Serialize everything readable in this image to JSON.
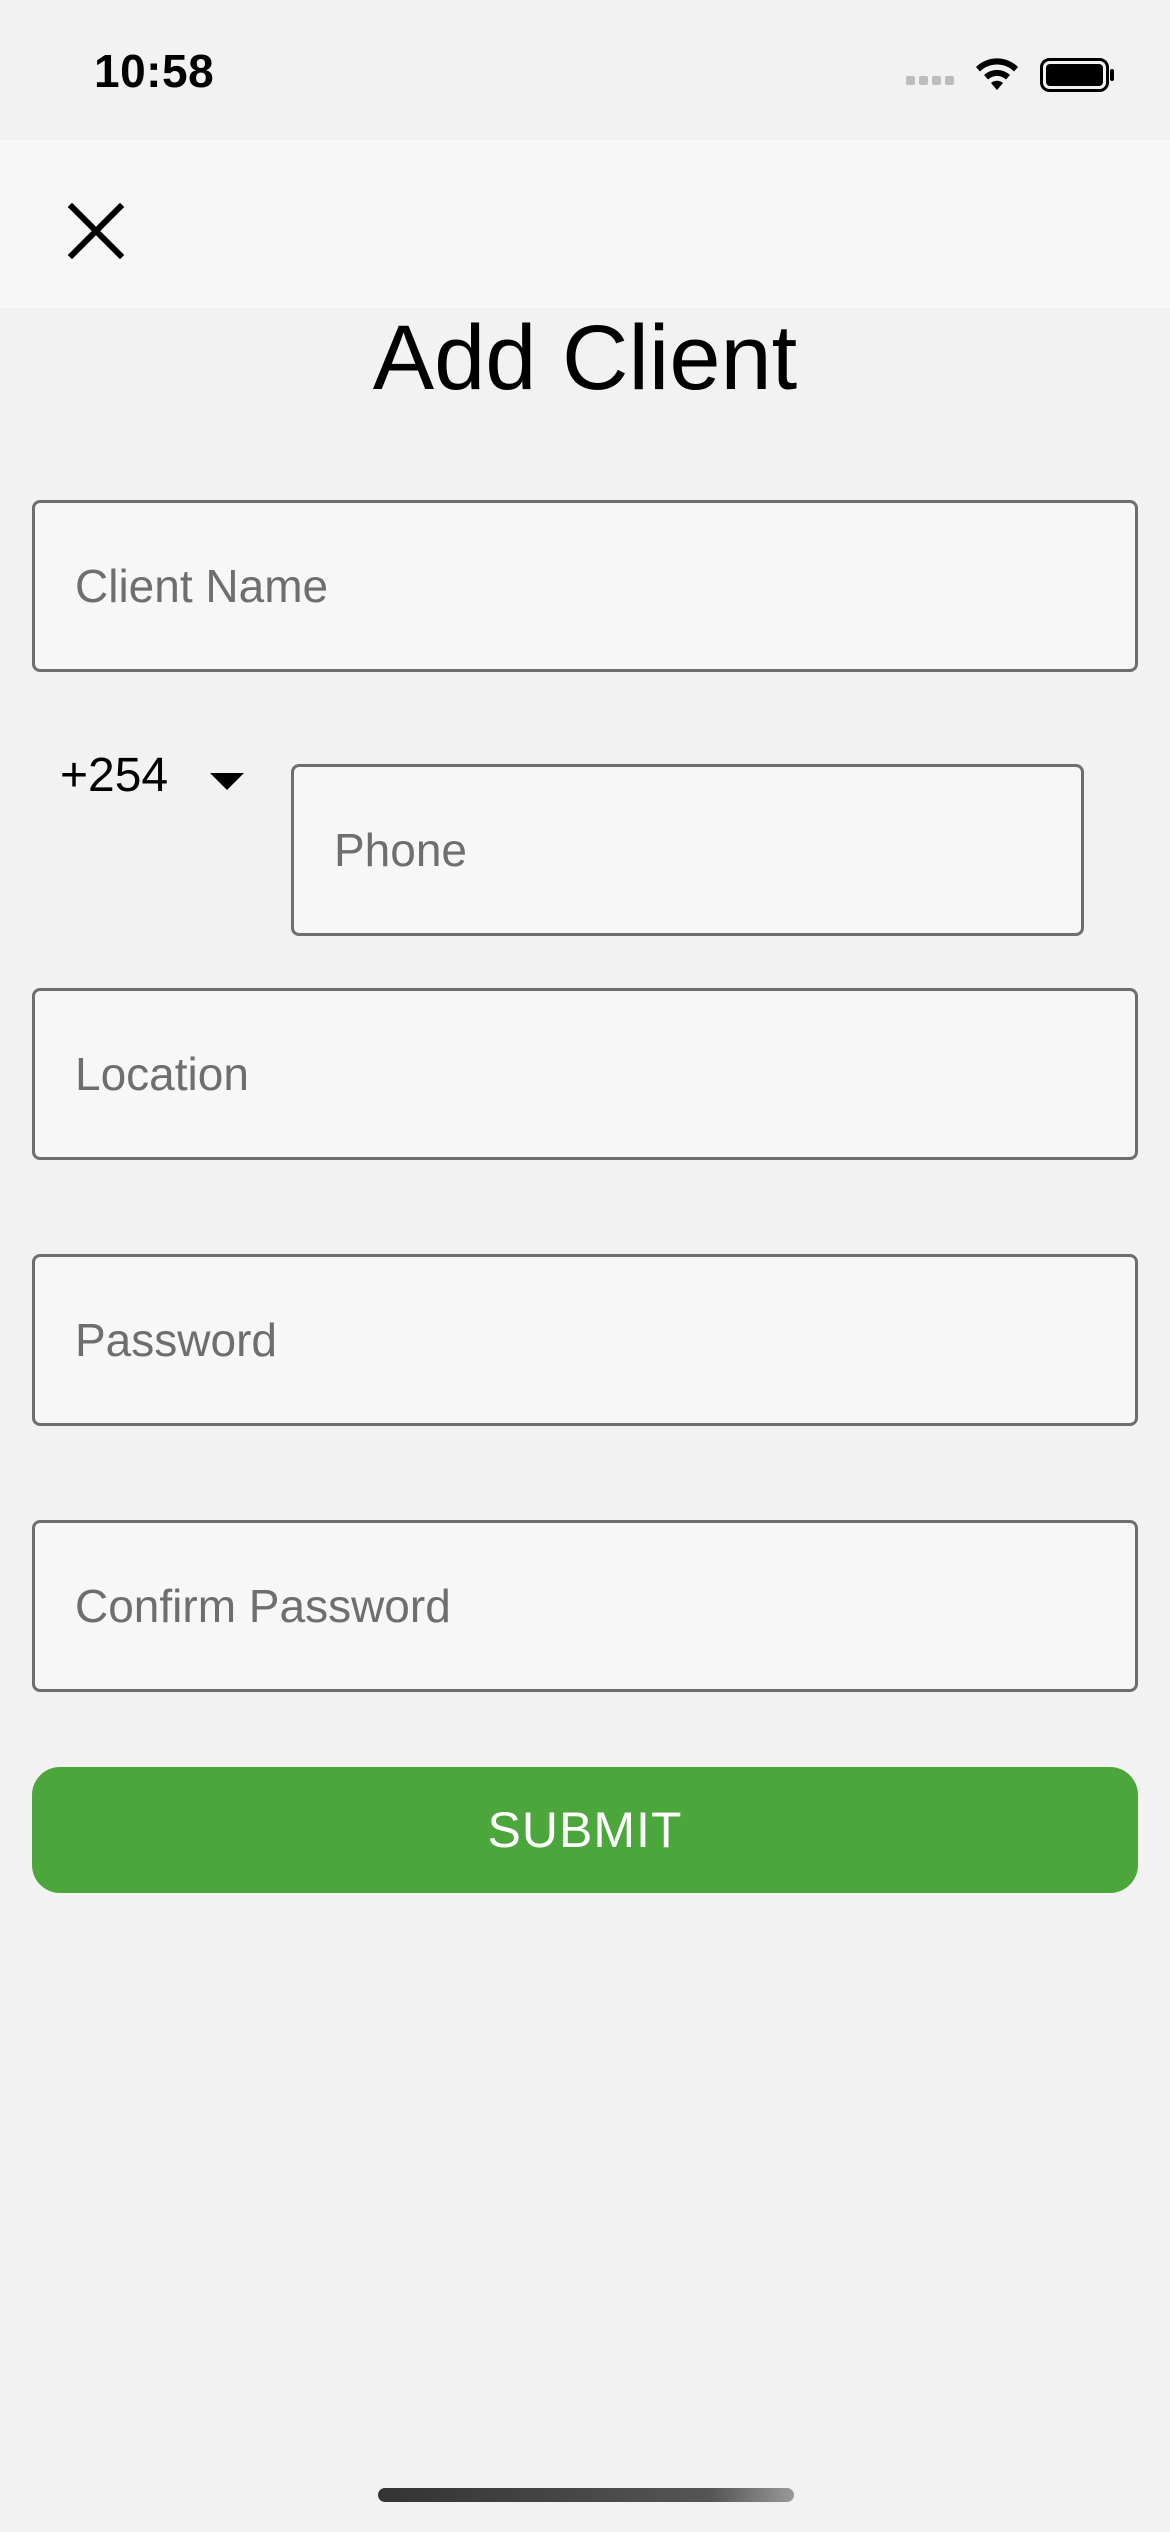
{
  "status_bar": {
    "time": "10:58",
    "icons": [
      "signal-icon",
      "wifi-icon",
      "battery-icon"
    ]
  },
  "nav": {
    "close_icon": "close-icon"
  },
  "page": {
    "title": "Add Client"
  },
  "form": {
    "client_name": {
      "placeholder": "Client Name",
      "value": ""
    },
    "country_code": {
      "value": "+254",
      "icon": "caret-down-icon"
    },
    "phone": {
      "placeholder": "Phone",
      "value": ""
    },
    "location": {
      "placeholder": "Location",
      "value": ""
    },
    "password": {
      "placeholder": "Password",
      "value": ""
    },
    "confirm_password": {
      "placeholder": "Confirm Password",
      "value": ""
    },
    "submit_label": "SUBMIT"
  },
  "colors": {
    "background": "#f2f2f2",
    "field_background": "#f7f7f7",
    "field_border": "#6e6e6e",
    "accent": "#4ba73c"
  }
}
